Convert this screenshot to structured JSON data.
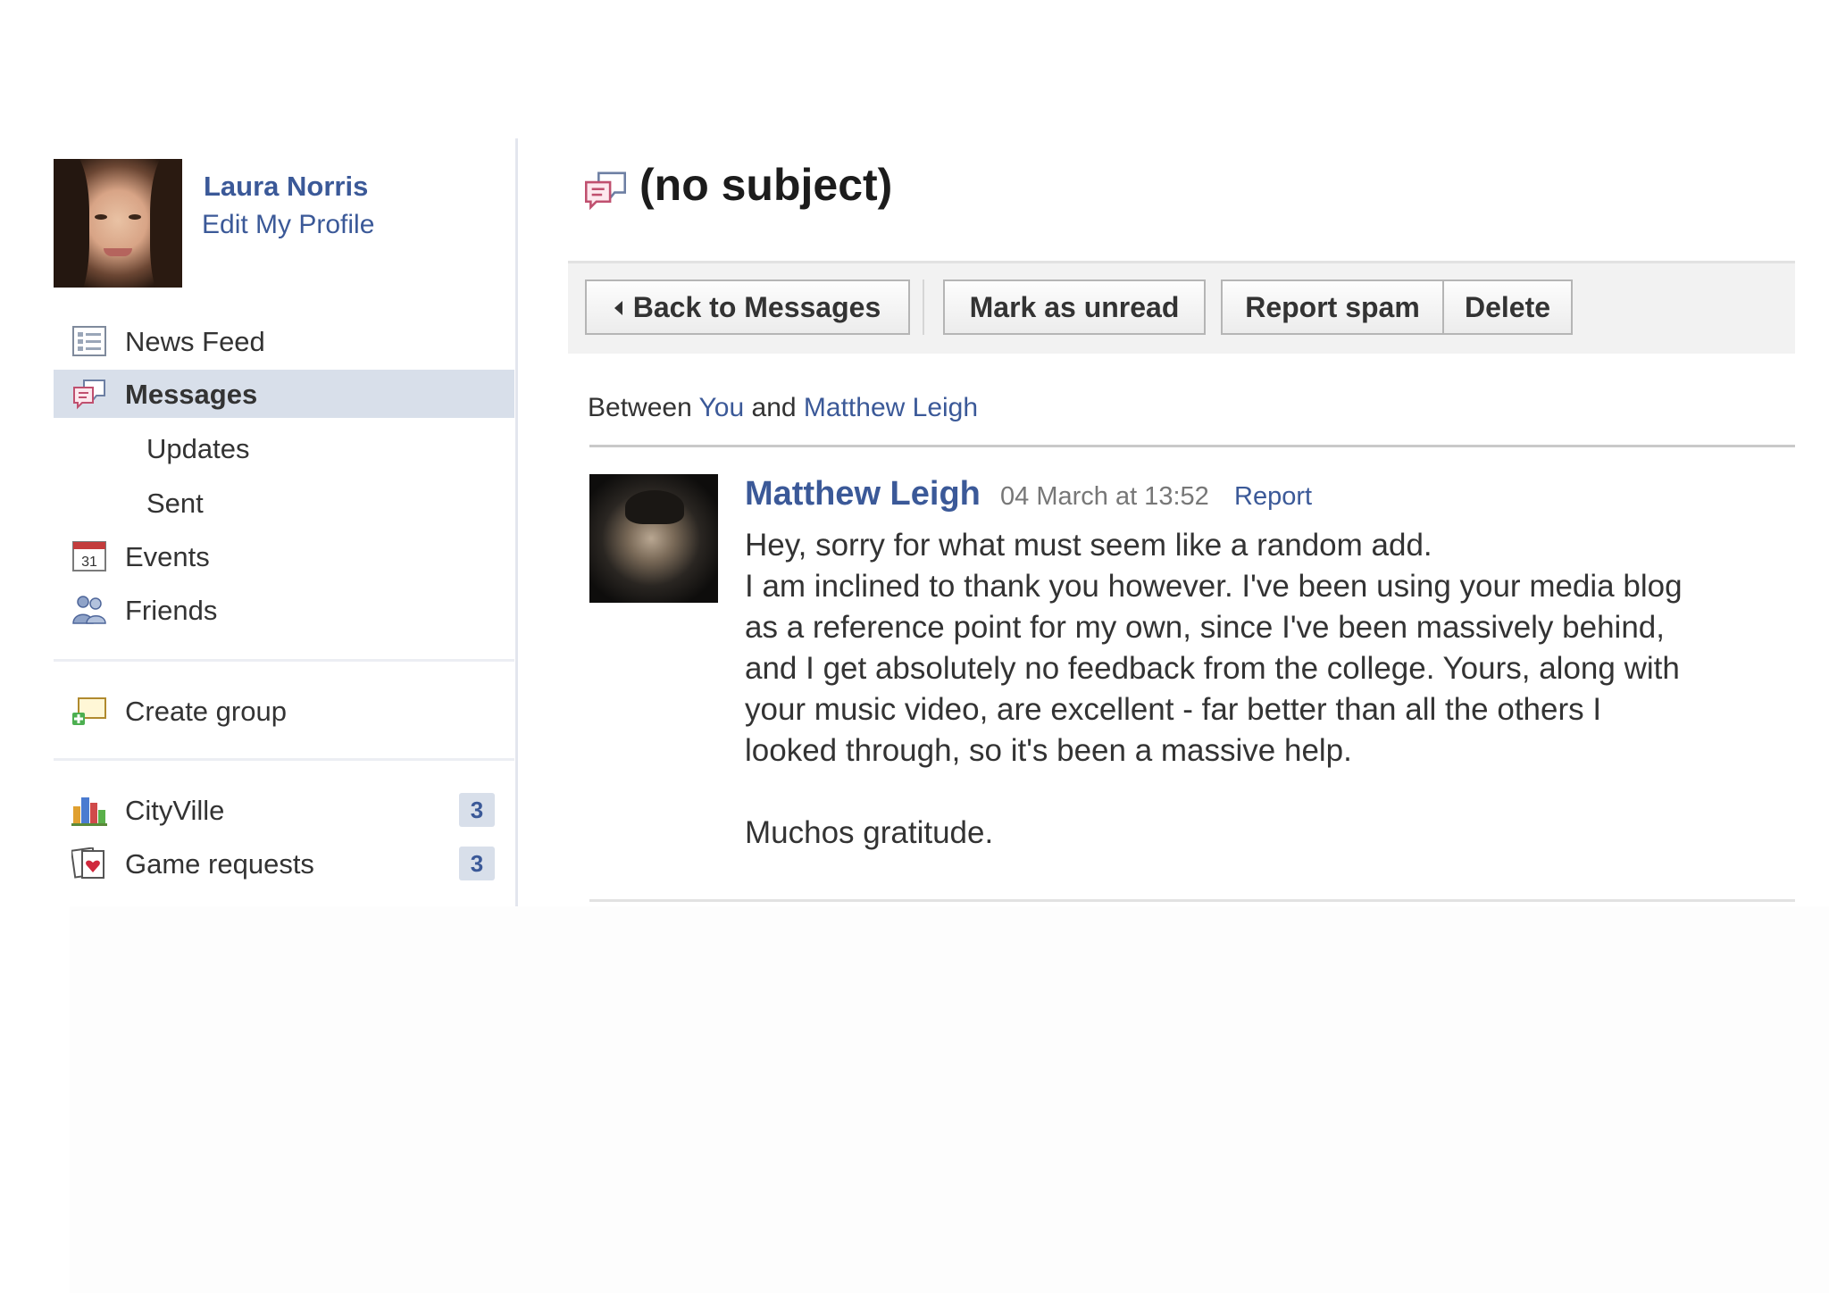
{
  "profile": {
    "name": "Laura Norris",
    "edit_link": "Edit My Profile"
  },
  "nav": {
    "main": [
      {
        "label": "News Feed",
        "icon": "news-feed-icon"
      },
      {
        "label": "Messages",
        "icon": "messages-icon",
        "active": true
      },
      {
        "label": "Updates",
        "sub": true
      },
      {
        "label": "Sent",
        "sub": true
      },
      {
        "label": "Events",
        "icon": "calendar-icon",
        "icon_text": "31"
      },
      {
        "label": "Friends",
        "icon": "friends-icon"
      }
    ],
    "groups": [
      {
        "label": "Create group",
        "icon": "create-group-icon"
      }
    ],
    "apps": [
      {
        "label": "CityVille",
        "icon": "cityville-icon",
        "badge": "3"
      },
      {
        "label": "Game requests",
        "icon": "game-requests-icon",
        "badge": "3"
      }
    ]
  },
  "thread": {
    "title": "(no subject)",
    "title_icon": "messages-icon",
    "toolbar": {
      "back": "Back to Messages",
      "unread": "Mark as unread",
      "spam": "Report spam",
      "delete": "Delete"
    },
    "participants": {
      "prefix": "Between",
      "you": "You",
      "conj": "and",
      "other": "Matthew Leigh"
    },
    "messages": [
      {
        "sender": "Matthew Leigh",
        "timestamp": "04 March at 13:52",
        "report": "Report",
        "lines": [
          "Hey, sorry for what must seem like a random add.",
          "I am inclined to thank you however. I've been using your media blog",
          "as a reference point for my own, since I've been massively behind,",
          "and I get absolutely no feedback from the college. Yours, along with",
          "your music video, are excellent - far better than all the others I",
          "looked through, so it's been a massive help.",
          "",
          "Muchos gratitude."
        ]
      }
    ]
  },
  "colors": {
    "link": "#3b5998",
    "active_bg": "#d8dfea",
    "text": "#333333"
  }
}
